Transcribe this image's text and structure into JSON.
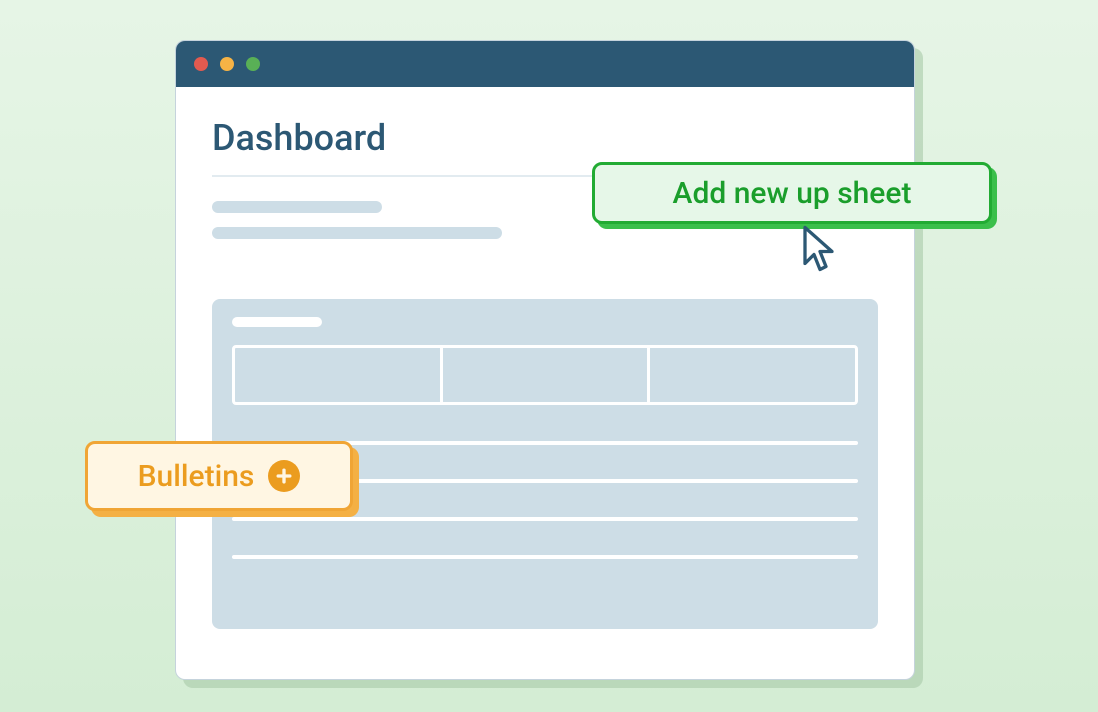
{
  "page": {
    "title": "Dashboard"
  },
  "callouts": {
    "add_sheet_label": "Add new up sheet",
    "bulletins_label": "Bulletins"
  }
}
